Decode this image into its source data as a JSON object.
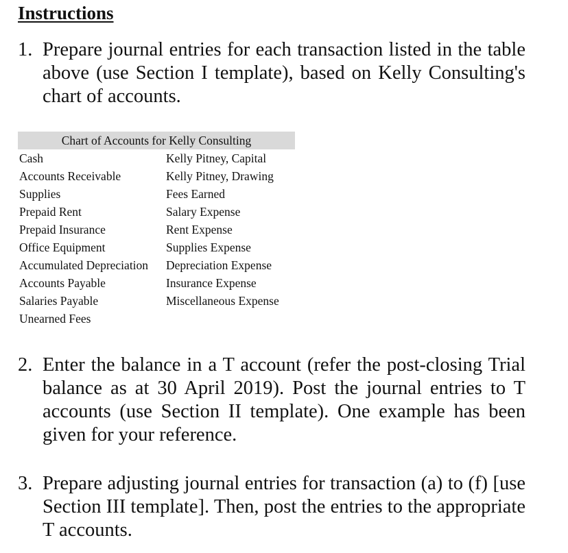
{
  "heading": "Instructions",
  "instructions": [
    {
      "number": "1.",
      "text": "Prepare journal entries for each transaction listed in the table above (use Section I template), based on Kelly Consulting's chart of accounts."
    },
    {
      "number": "2.",
      "text": "Enter the balance in a T account (refer the post-closing Trial balance as at 30 April 2019). Post the journal entries to T accounts (use Section II template). One example has been given for your reference."
    },
    {
      "number": "3.",
      "text": "Prepare adjusting journal entries for transaction (a) to (f) [use Section III template]. Then, post the entries to the appropriate T accounts."
    }
  ],
  "chart_of_accounts": {
    "title": "Chart of Accounts for Kelly Consulting",
    "header_bg": "#d9d9d9",
    "left_column": [
      "Cash",
      "Accounts Receivable",
      "Supplies",
      "Prepaid Rent",
      "Prepaid Insurance",
      "Office Equipment",
      "Accumulated Depreciation",
      "Accounts Payable",
      "Salaries Payable",
      "Unearned Fees"
    ],
    "right_column": [
      "Kelly Pitney, Capital",
      "Kelly Pitney, Drawing",
      "Fees Earned",
      "Salary Expense",
      "Rent Expense",
      "Supplies Expense",
      "Depreciation Expense",
      "Insurance Expense",
      "Miscellaneous Expense"
    ]
  }
}
